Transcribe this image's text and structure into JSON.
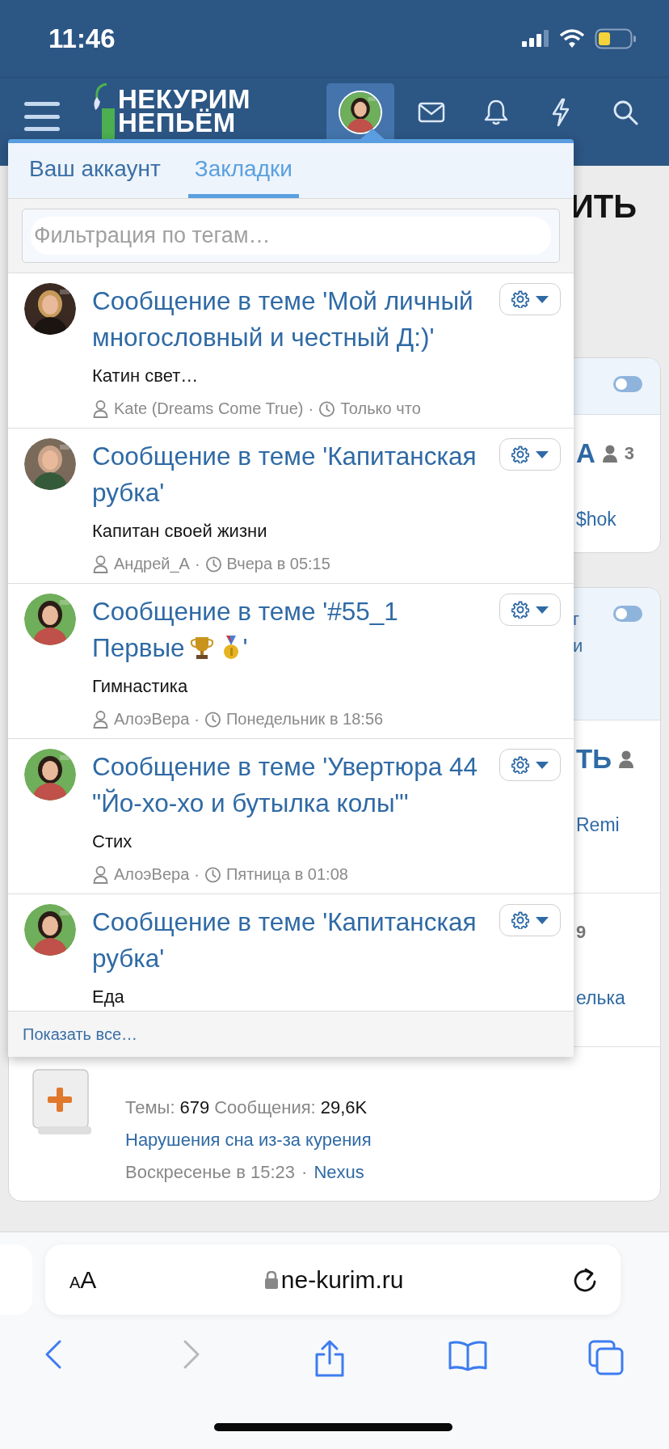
{
  "status_bar": {
    "time": "11:46"
  },
  "nav": {
    "logo_lines": [
      "НЕКУРИМ",
      "НЕПЬЁМ"
    ],
    "icons": [
      {
        "kind": "avatar",
        "selected": true
      },
      {
        "kind": "mail",
        "selected": false
      },
      {
        "kind": "bell",
        "selected": false
      },
      {
        "kind": "bolt",
        "selected": false
      },
      {
        "kind": "search",
        "selected": false
      }
    ]
  },
  "page": {
    "heading": "ИТЬ",
    "cards": [
      {
        "toggle_on": false,
        "rows": [
          {
            "title": "А",
            "count": "3",
            "link": "$hok"
          }
        ]
      },
      {
        "toggle_on": false,
        "header_lines": [
          "г",
          "и"
        ],
        "rows": [
          {
            "title": "ТЬ",
            "link": "Remi"
          },
          {
            "count": "9",
            "link": "елька"
          }
        ],
        "forum": {
          "stats": [
            {
              "label": "Темы:",
              "value": "679"
            },
            {
              "label": "Сообщения:",
              "value": "29,6K"
            }
          ],
          "last_post": "Нарушения сна из-за курения",
          "date": "Воскресенье в 15:23",
          "separator": "·",
          "author": "Nexus"
        }
      }
    ]
  },
  "menu": {
    "tabs": [
      {
        "label": "Ваш аккаунт",
        "selected": false
      },
      {
        "label": "Закладки",
        "selected": true
      }
    ],
    "filter": {
      "placeholder": "Фильтрация по тегам…"
    },
    "bookmarks": [
      {
        "title": "Сообщение в теме 'Мой личный многословный и честный Д:)'",
        "snippet": "Катин свет…",
        "author": "Kate (Dreams Come True)",
        "separator": "·",
        "time": "Только что"
      },
      {
        "title": "Сообщение в теме 'Капитанская рубка'",
        "snippet": "Капитан своей жизни",
        "author": "Андрей_А",
        "separator": "·",
        "time": "Вчера в 05:15"
      },
      {
        "title": "Сообщение в теме '#55_1 Первые",
        "icons": [
          {
            "kind": "trophy"
          },
          {
            "kind": "medal"
          }
        ],
        "title_end": "'",
        "snippet": "Гимнастика",
        "author": "АлоэВера",
        "separator": "·",
        "time": "Понедельник в 18:56"
      },
      {
        "title": "Сообщение в теме 'Увертюра 44 \"Йо-хо-хо и бутылка колы\"'",
        "snippet": "Стих",
        "author": "АлоэВера",
        "separator": "·",
        "time": "Пятница в 01:08"
      },
      {
        "title": "Сообщение в теме 'Капитанская рубка'",
        "snippet": "Еда"
      }
    ],
    "footer_link": "Показать все…"
  },
  "browser": {
    "format_button": "AA",
    "url": "ne-kurim.ru",
    "toolbar": [
      {
        "kind": "back",
        "disabled": false
      },
      {
        "kind": "forward",
        "disabled": true
      },
      {
        "kind": "share",
        "disabled": false
      },
      {
        "kind": "bookmarks",
        "disabled": false
      },
      {
        "kind": "tabs",
        "disabled": false
      }
    ]
  }
}
